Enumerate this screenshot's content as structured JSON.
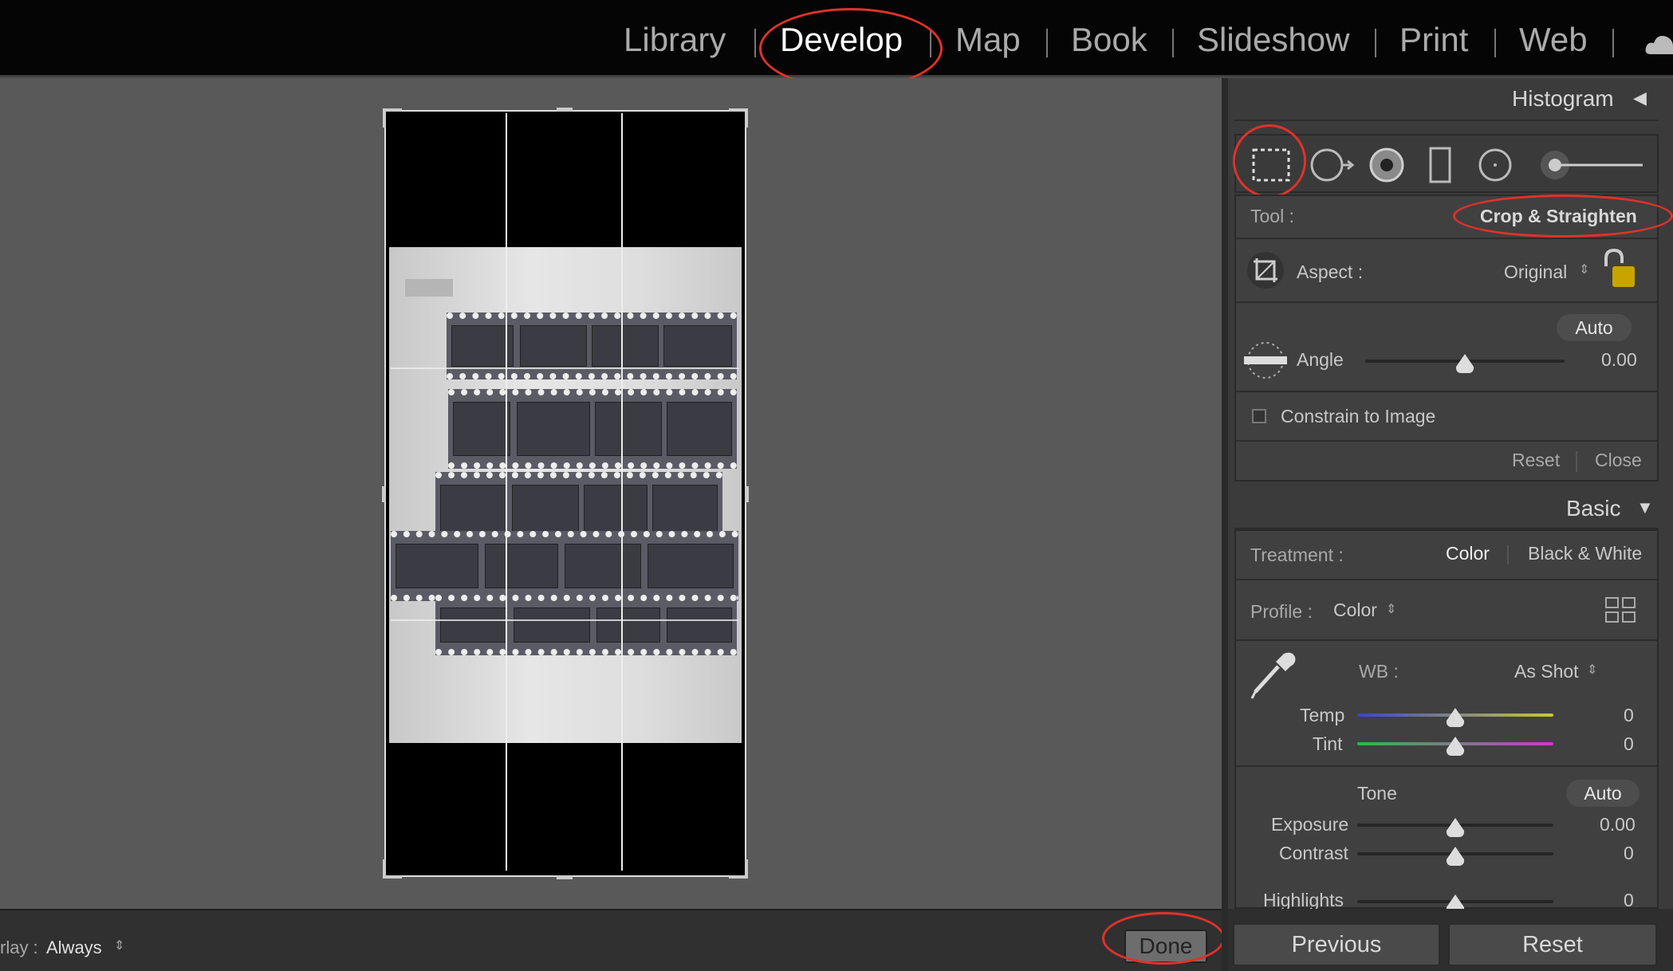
{
  "top_nav": {
    "modules": [
      "Library",
      "Develop",
      "Map",
      "Book",
      "Slideshow",
      "Print",
      "Web"
    ],
    "active": "Develop"
  },
  "histogram_panel": {
    "title": "Histogram",
    "collapse_glyph": "◀"
  },
  "toolstrip": {
    "tools": [
      "crop-overlay-icon",
      "spot-removal-icon",
      "red-eye-icon",
      "graduated-filter-icon",
      "radial-filter-icon",
      "adjustment-brush-icon"
    ],
    "selected": "crop-overlay-icon"
  },
  "crop_panel": {
    "tool_label": "Tool :",
    "tool_value": "Crop & Straighten",
    "aspect_label": "Aspect :",
    "aspect_value": "Original",
    "auto_label": "Auto",
    "angle_label": "Angle",
    "angle_value": "0.00",
    "angle_level": 0.5,
    "constrain_label": "Constrain to Image",
    "constrain_checked": false,
    "reset_label": "Reset",
    "close_label": "Close"
  },
  "basic_panel": {
    "title": "Basic",
    "collapse_glyph": "▼",
    "treatment_label": "Treatment :",
    "treatment_color": "Color",
    "treatment_bw": "Black & White",
    "profile_label": "Profile :",
    "profile_value": "Color",
    "wb_label": "WB :",
    "wb_value": "As Shot",
    "temp_label": "Temp",
    "temp_value": "0",
    "tint_label": "Tint",
    "tint_value": "0",
    "tone_label": "Tone",
    "tone_auto": "Auto",
    "exposure_label": "Exposure",
    "exposure_value": "0.00",
    "contrast_label": "Contrast",
    "contrast_value": "0",
    "highlights_label": "Highlights",
    "highlights_value": "0"
  },
  "bottom_bar": {
    "overlay_label": "rlay :",
    "overlay_value": "Always",
    "done_label": "Done"
  },
  "footer_buttons": {
    "previous": "Previous",
    "reset": "Reset"
  },
  "colors": {
    "annotation_ring": "#e0322a",
    "background": "#595959",
    "panel": "#3b3b3b"
  }
}
